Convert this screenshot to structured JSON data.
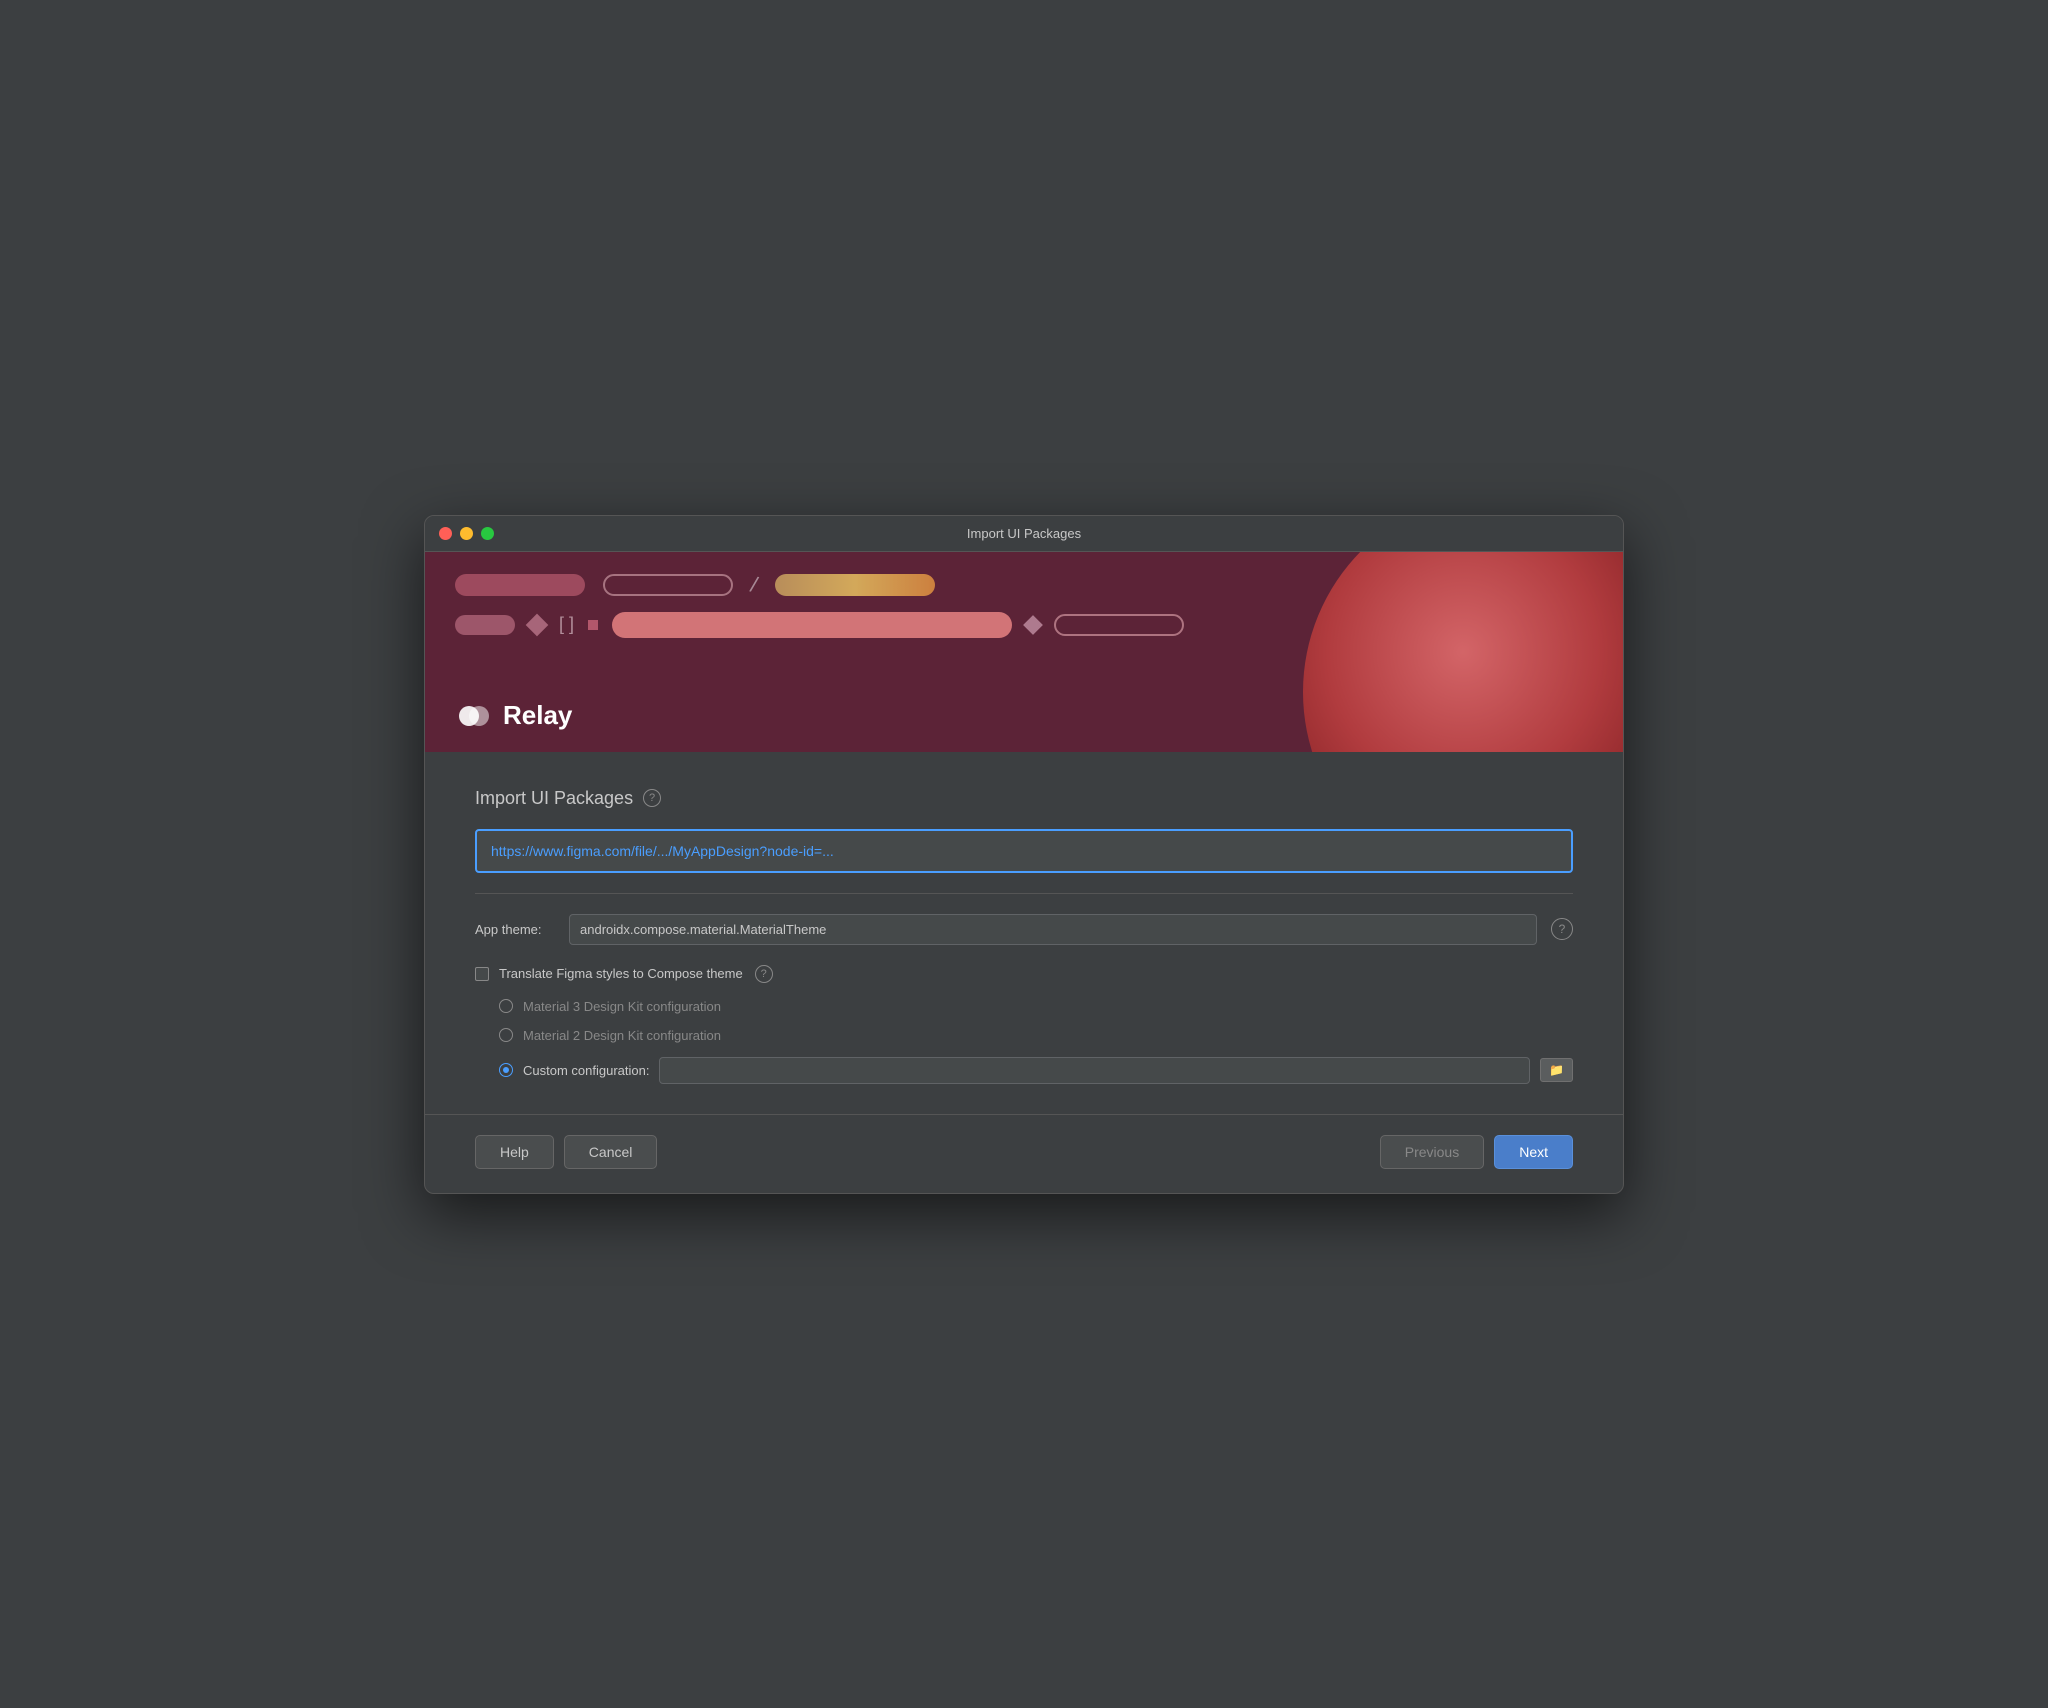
{
  "window": {
    "title": "Import UI Packages"
  },
  "banner": {
    "logo_text": "Relay"
  },
  "content": {
    "section_title": "Import UI Packages",
    "help_tooltip": "?",
    "url_input": {
      "value": "https://www.figma.com/file/.../MyAppDesign?node-id=...",
      "placeholder": "https://www.figma.com/file/.../MyAppDesign?node-id=..."
    },
    "app_theme": {
      "label": "App theme:",
      "value": "androidx.compose.material.MaterialTheme",
      "help": "?"
    },
    "translate_checkbox": {
      "label": "Translate Figma styles to Compose theme",
      "help": "?"
    },
    "radio_options": [
      {
        "id": "material3",
        "label": "Material 3 Design Kit configuration",
        "selected": false
      },
      {
        "id": "material2",
        "label": "Material 2 Design Kit configuration",
        "selected": false
      },
      {
        "id": "custom",
        "label": "Custom configuration:",
        "selected": true
      }
    ]
  },
  "footer": {
    "help_label": "Help",
    "cancel_label": "Cancel",
    "previous_label": "Previous",
    "next_label": "Next"
  }
}
